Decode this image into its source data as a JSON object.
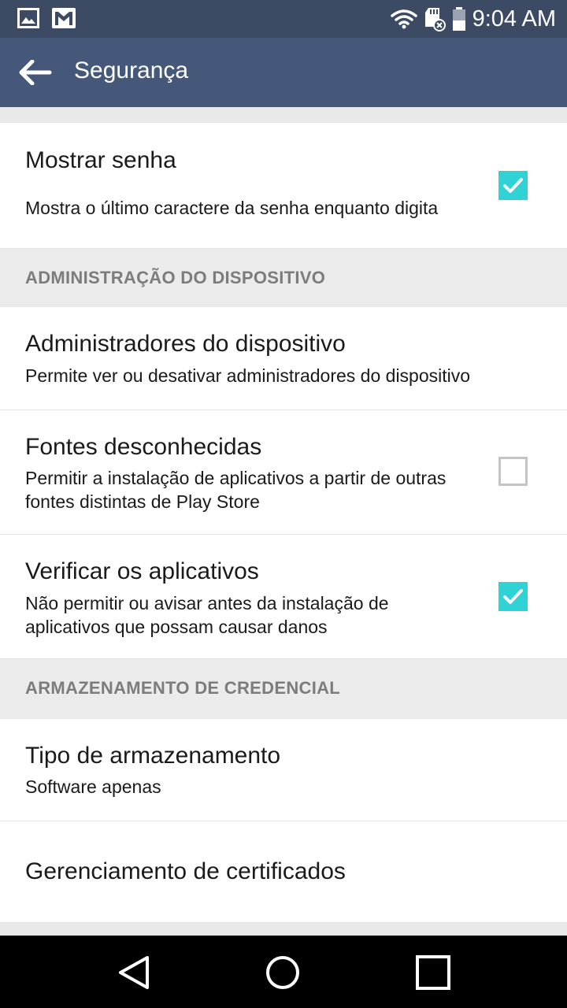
{
  "status_bar": {
    "time": "9:04 AM",
    "left_icons": [
      "image-icon",
      "gmail-icon"
    ],
    "right_icons": [
      "wifi-icon",
      "sd-card-icon",
      "battery-icon"
    ]
  },
  "app_bar": {
    "title": "Segurança",
    "back_icon": "arrow-left-icon"
  },
  "settings": {
    "show_password": {
      "title": "Mostrar senha",
      "summary": "Mostra o último caractere da senha enquanto digita",
      "checked": true
    },
    "device_admin_header": "ADMINISTRAÇÃO DO DISPOSITIVO",
    "device_admins": {
      "title": "Administradores do dispositivo",
      "summary": "Permite ver ou desativar administradores do dispositivo"
    },
    "unknown_sources": {
      "title": "Fontes desconhecidas",
      "summary": "Permitir a instalação de aplicativos a partir de outras fontes distintas de Play Store",
      "checked": false
    },
    "verify_apps": {
      "title": "Verificar os aplicativos",
      "summary": "Não permitir ou avisar antes da instalação de aplicativos que possam causar danos",
      "checked": true
    },
    "credential_header": "ARMAZENAMENTO DE CREDENCIAL",
    "storage_type": {
      "title": "Tipo de armazenamento",
      "summary": "Software apenas"
    },
    "certificate_management": {
      "title": "Gerenciamento de certificados"
    }
  },
  "colors": {
    "status_bar": "#3c4a63",
    "app_bar": "#46587a",
    "accent": "#2fd3d6",
    "section_header_text": "#7c7c7c"
  },
  "nav_bar": {
    "icons": [
      "back-triangle-icon",
      "home-circle-icon",
      "recents-square-icon"
    ]
  }
}
